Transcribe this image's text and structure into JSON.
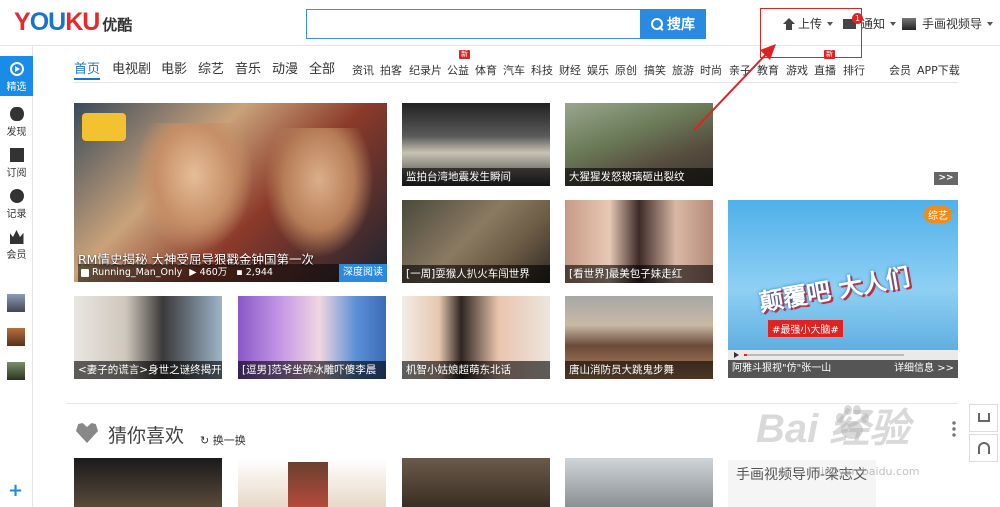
{
  "logo": {
    "en_y": "Y",
    "en_ou": "OU",
    "en_ku": "KU",
    "cn": "优酷"
  },
  "search": {
    "value": "",
    "placeholder": "",
    "button": "搜库"
  },
  "header": {
    "upload": "上传",
    "notify": "通知",
    "notify_count": "1",
    "user": "手画视频导"
  },
  "sidebar": {
    "items": [
      {
        "label": "精选",
        "icon": "play-icon"
      },
      {
        "label": "发现",
        "icon": "eye-icon"
      },
      {
        "label": "订阅",
        "icon": "rss-icon"
      },
      {
        "label": "记录",
        "icon": "clock-icon"
      },
      {
        "label": "会员",
        "icon": "crown-icon"
      }
    ],
    "plus": "+"
  },
  "nav": {
    "main": [
      "首页",
      "电视剧",
      "电影",
      "综艺",
      "音乐",
      "动漫",
      "全部"
    ],
    "sub": [
      "资讯",
      "拍客",
      "纪录片",
      "公益",
      "体育",
      "汽车",
      "科技",
      "财经",
      "娱乐",
      "原创",
      "搞笑",
      "旅游",
      "时尚",
      "亲子",
      "教育",
      "游戏",
      "直播",
      "排行"
    ],
    "right": [
      "会员",
      "APP下载"
    ],
    "new_label": "新"
  },
  "hero": {
    "title": "RM情史揭秘 大神受屈导狠戳金钟国第一次",
    "user": "Running_Man_Only",
    "plays": "460万",
    "comments": "2,944",
    "badge": "深度阅读"
  },
  "tiles": [
    {
      "caption": "监拍台湾地震发生瞬间"
    },
    {
      "caption": "大猩猩发怒玻璃砸出裂纹"
    },
    {
      "caption": "[一周]耍猴人扒火车闯世界"
    },
    {
      "caption": "[看世界]最美包子妹走红"
    },
    {
      "caption": "<妻子的谎言>身世之谜终揭开"
    },
    {
      "caption": "[逗男]范爷坐碎冰雕吓傻李晨"
    },
    {
      "caption": "机智小姑娘超萌东北话"
    },
    {
      "caption": "唐山消防员大跳鬼步舞"
    }
  ],
  "more": ">>",
  "variety": {
    "badge": "综艺",
    "title": "颠覆吧 大人们",
    "sub": "#最强小大脑#",
    "caption": "阿雅斗狠视\"仿\"张一山",
    "details": "详细信息 >>",
    "progress": 0.02
  },
  "section2": {
    "title": "猜你喜欢",
    "refresh": "换一换",
    "card": "手画视频导师-梁志文"
  },
  "watermark": {
    "main": "Bai  经验",
    "sub": "jingyan.baidu.com"
  },
  "colors": {
    "brand_blue": "#1a74cf",
    "brand_red": "#e62a2a",
    "accent": "#2a8ae0",
    "annotation": "#e02222"
  }
}
